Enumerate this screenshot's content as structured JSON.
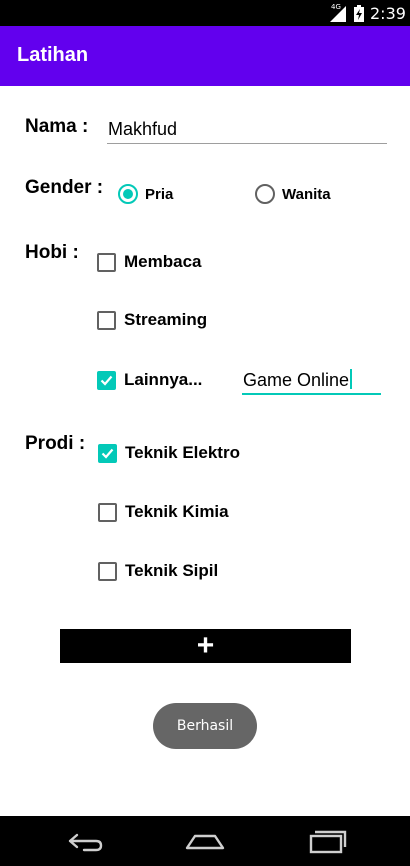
{
  "status_bar": {
    "network": "4G",
    "time": "2:39"
  },
  "app_bar": {
    "title": "Latihan"
  },
  "form": {
    "nama_label": "Nama :",
    "nama_value": "Makhfud",
    "gender_label": "Gender :",
    "gender_options": [
      "Pria",
      "Wanita"
    ],
    "gender_selected": "Pria",
    "hobi_label": "Hobi :",
    "hobi_options": [
      {
        "label": "Membaca",
        "checked": false
      },
      {
        "label": "Streaming",
        "checked": false
      },
      {
        "label": "Lainnya...",
        "checked": true
      }
    ],
    "hobi_other_value": "Game Online",
    "prodi_label": "Prodi :",
    "prodi_options": [
      {
        "label": "Teknik Elektro",
        "checked": true
      },
      {
        "label": "Teknik Kimia",
        "checked": false
      },
      {
        "label": "Teknik Sipil",
        "checked": false
      }
    ]
  },
  "actions": {
    "add_symbol": "+",
    "submit_label": "Berhasil"
  },
  "colors": {
    "app_bar": "#6200ee",
    "accent": "#03c9b8",
    "pill": "#666666"
  },
  "icons": {
    "back": "back-icon",
    "home": "home-icon",
    "recents": "recents-icon"
  }
}
